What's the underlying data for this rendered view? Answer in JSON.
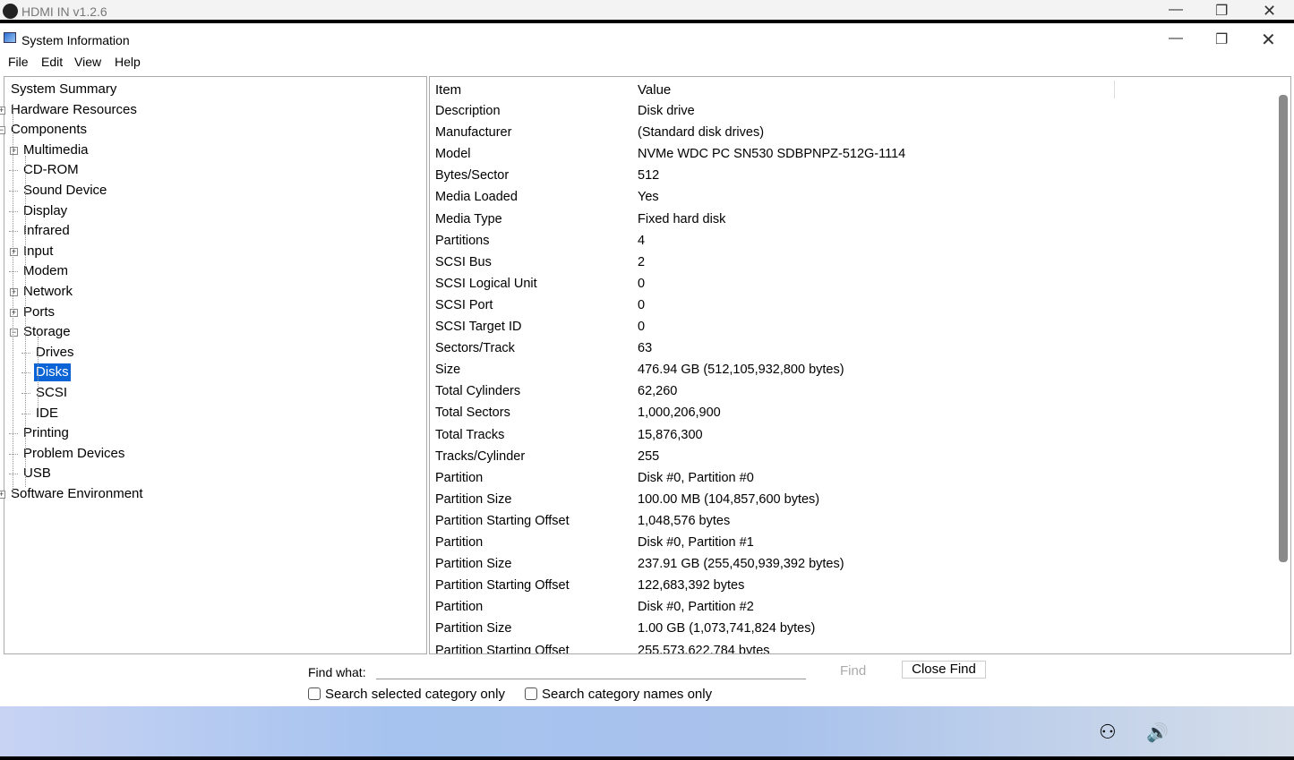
{
  "outer_window": {
    "title": "HDMI IN v1.2.6"
  },
  "app": {
    "title": "System Information"
  },
  "menu": [
    "File",
    "Edit",
    "View",
    "Help"
  ],
  "tree": [
    {
      "label": "System Summary",
      "level": 0,
      "expander": ""
    },
    {
      "label": "Hardware Resources",
      "level": 0,
      "expander": "+"
    },
    {
      "label": "Components",
      "level": 0,
      "expander": "-"
    },
    {
      "label": "Multimedia",
      "level": 1,
      "expander": "+"
    },
    {
      "label": "CD-ROM",
      "level": 1,
      "expander": ""
    },
    {
      "label": "Sound Device",
      "level": 1,
      "expander": ""
    },
    {
      "label": "Display",
      "level": 1,
      "expander": ""
    },
    {
      "label": "Infrared",
      "level": 1,
      "expander": ""
    },
    {
      "label": "Input",
      "level": 1,
      "expander": "+"
    },
    {
      "label": "Modem",
      "level": 1,
      "expander": ""
    },
    {
      "label": "Network",
      "level": 1,
      "expander": "+"
    },
    {
      "label": "Ports",
      "level": 1,
      "expander": "+"
    },
    {
      "label": "Storage",
      "level": 1,
      "expander": "-"
    },
    {
      "label": "Drives",
      "level": 2,
      "expander": ""
    },
    {
      "label": "Disks",
      "level": 2,
      "expander": "",
      "selected": true
    },
    {
      "label": "SCSI",
      "level": 2,
      "expander": ""
    },
    {
      "label": "IDE",
      "level": 2,
      "expander": ""
    },
    {
      "label": "Printing",
      "level": 1,
      "expander": ""
    },
    {
      "label": "Problem Devices",
      "level": 1,
      "expander": ""
    },
    {
      "label": "USB",
      "level": 1,
      "expander": ""
    },
    {
      "label": "Software Environment",
      "level": 0,
      "expander": "+"
    }
  ],
  "details": {
    "headers": {
      "item": "Item",
      "value": "Value"
    },
    "rows": [
      [
        "Description",
        "Disk drive"
      ],
      [
        "Manufacturer",
        "(Standard disk drives)"
      ],
      [
        "Model",
        "NVMe WDC PC SN530 SDBPNPZ-512G-1114"
      ],
      [
        "Bytes/Sector",
        "512"
      ],
      [
        "Media Loaded",
        "Yes"
      ],
      [
        "Media Type",
        "Fixed hard disk"
      ],
      [
        "Partitions",
        "4"
      ],
      [
        "SCSI Bus",
        "2"
      ],
      [
        "SCSI Logical Unit",
        "0"
      ],
      [
        "SCSI Port",
        "0"
      ],
      [
        "SCSI Target ID",
        "0"
      ],
      [
        "Sectors/Track",
        "63"
      ],
      [
        "Size",
        "476.94 GB (512,105,932,800 bytes)"
      ],
      [
        "Total Cylinders",
        "62,260"
      ],
      [
        "Total Sectors",
        "1,000,206,900"
      ],
      [
        "Total Tracks",
        "15,876,300"
      ],
      [
        "Tracks/Cylinder",
        "255"
      ],
      [
        "Partition",
        "Disk #0, Partition #0"
      ],
      [
        "Partition Size",
        "100.00 MB (104,857,600 bytes)"
      ],
      [
        "Partition Starting Offset",
        "1,048,576 bytes"
      ],
      [
        "Partition",
        "Disk #0, Partition #1"
      ],
      [
        "Partition Size",
        "237.91 GB (255,450,939,392 bytes)"
      ],
      [
        "Partition Starting Offset",
        "122,683,392 bytes"
      ],
      [
        "Partition",
        "Disk #0, Partition #2"
      ],
      [
        "Partition Size",
        "1.00 GB (1,073,741,824 bytes)"
      ],
      [
        "Partition Starting Offset",
        "255,573,622,784 bytes"
      ]
    ]
  },
  "find": {
    "label": "Find what:",
    "value": "",
    "find_button": "Find",
    "close_button": "Close Find",
    "check1": "Search selected category only",
    "check2": "Search category names only"
  },
  "accent": "#0a64d6"
}
